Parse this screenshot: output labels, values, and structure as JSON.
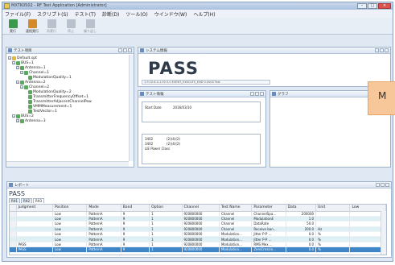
{
  "window": {
    "title": "MXTK0502 - RF Test Application [Administrator]"
  },
  "menu": [
    "ファイル(F)",
    "スクリプト(S)",
    "テスト(T)",
    "診断(D)",
    "ツール(O)",
    "ウインドウ(W)",
    "ヘルプ(H)"
  ],
  "toolbar": [
    {
      "label": "実行",
      "icon": "run-icon"
    },
    {
      "label": "連続実行",
      "icon": "batch-run-icon"
    },
    {
      "label": "再実行",
      "icon": "rerun-icon"
    },
    {
      "label": "停止",
      "icon": "stop-icon"
    },
    {
      "label": "繰り返し",
      "icon": "repeat-icon"
    }
  ],
  "test_panel": {
    "title": "テスト項目",
    "nodes": [
      {
        "label": "Default.spt",
        "icon": "script-icon"
      },
      {
        "label": "BUS=1",
        "icon": "folder-icon"
      },
      {
        "label": "Antenna=1",
        "icon": "antenna-icon"
      },
      {
        "label": "Channel=1",
        "icon": "channel-icon"
      },
      {
        "label": "ModulationQuality=1",
        "icon": "test-icon"
      },
      {
        "label": "Antenna=2",
        "icon": "antenna-icon"
      },
      {
        "label": "Channel=2",
        "icon": "channel-icon"
      },
      {
        "label": "ModulationQuality=2",
        "icon": "test-icon"
      },
      {
        "label": "TransmitterFrequencyOffset=1",
        "icon": "test-icon"
      },
      {
        "label": "TransmitterAdjacentChannelPow",
        "icon": "test-icon"
      },
      {
        "label": "VMMMeasurement=1",
        "icon": "test-icon"
      },
      {
        "label": "TestVector=1",
        "icon": "test-icon"
      },
      {
        "label": "BUS=2",
        "icon": "folder-icon"
      },
      {
        "label": "Antenna=3",
        "icon": "antenna-icon"
      }
    ]
  },
  "system_panel": {
    "title": "システム情報",
    "result": "PASS",
    "id_line": "1.9.10.6.0-1.00 0.0 EVENT_EXECUTE_END 0.0000 Test"
  },
  "test_info_panel": {
    "title": "テスト情報",
    "start_label": "Start Date",
    "start_value": "2016/03/10",
    "rows": [
      "3402",
      "3402",
      "LIE Power Class"
    ],
    "row_values": [
      "(2)(4)(2)",
      "(2)(4)(2)",
      ""
    ]
  },
  "graph_panel": {
    "title": "グラフ"
  },
  "callout": {
    "text": "M"
  },
  "report": {
    "title": "レポート",
    "result": "PASS",
    "tabs": [
      "Rlt1",
      "Rlt2",
      "Rlt3"
    ],
    "columns": [
      "Judgment",
      "Position",
      "Mode",
      "Band",
      "Option",
      "Channel",
      "Test Name",
      "Parameter",
      "Data",
      "Unit",
      "Low"
    ],
    "rows": [
      [
        "",
        "Low",
        "PatternA",
        "9",
        "1",
        "920800000",
        "Channel",
        "ChannelSpa...",
        "200000",
        "",
        ""
      ],
      [
        "",
        "Low",
        "PatternA",
        "9",
        "1",
        "920800000",
        "Channel",
        "ModulationE",
        "1.0",
        "",
        ""
      ],
      [
        "",
        "Low",
        "PatternA",
        "9",
        "1",
        "920800000",
        "Channel",
        "DataRate",
        "50.0",
        "",
        ""
      ],
      [
        "",
        "Low",
        "PatternA",
        "9",
        "1",
        "920800000",
        "Channel",
        "Receive ban...",
        "200.0",
        "Hz",
        ""
      ],
      [
        "",
        "Low",
        "PatternA",
        "9",
        "1",
        "920800000",
        "Modulation...",
        "Jitter P-P ...",
        "0.0",
        "%",
        ""
      ],
      [
        "",
        "Low",
        "PatternA",
        "9",
        "1",
        "920800000",
        "Modulation...",
        "Jitter P-P ...",
        "0.0",
        "%",
        ""
      ],
      [
        "PASS",
        "Low",
        "PatternA",
        "9",
        "1",
        "920800000",
        "Modulation...",
        "RMS Mex ...",
        "0.0",
        "%",
        ""
      ],
      [
        "PASS",
        "Low",
        "PatternA",
        "9",
        "1",
        "920800000",
        "Modulation...",
        "ZeroCrossin...",
        "0.0",
        "%",
        ""
      ]
    ],
    "selected_row": 7
  }
}
